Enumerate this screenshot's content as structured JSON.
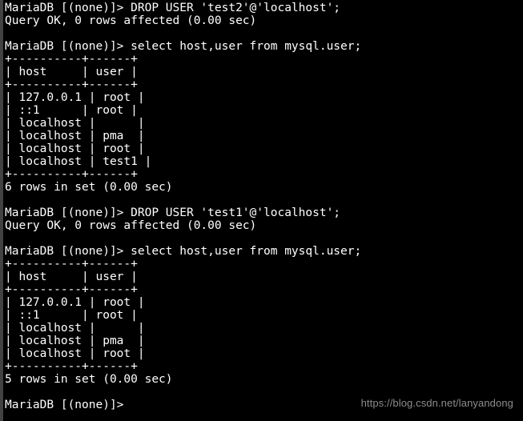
{
  "terminal": {
    "prompt": "MariaDB [(none)]> ",
    "background_color": "#000000",
    "foreground_color": "#ffffff",
    "lines": [
      "MariaDB [(none)]> DROP USER 'test2'@'localhost';",
      "Query OK, 0 rows affected (0.00 sec)",
      "",
      "MariaDB [(none)]> select host,user from mysql.user;",
      "+----------+------+",
      "| host     | user |",
      "+----------+------+",
      "| 127.0.0.1 | root |",
      "| ::1      | root |",
      "| localhost |      |",
      "| localhost | pma  |",
      "| localhost | root |",
      "| localhost | test1 |",
      "+----------+------+",
      "6 rows in set (0.00 sec)",
      "",
      "MariaDB [(none)]> DROP USER 'test1'@'localhost';",
      "Query OK, 0 rows affected (0.00 sec)",
      "",
      "MariaDB [(none)]> select host,user from mysql.user;",
      "+----------+------+",
      "| host     | user |",
      "+----------+------+",
      "| 127.0.0.1 | root |",
      "| ::1      | root |",
      "| localhost |      |",
      "| localhost | pma  |",
      "| localhost | root |",
      "+----------+------+",
      "5 rows in set (0.00 sec)",
      "",
      "MariaDB [(none)]> "
    ],
    "commands": [
      {
        "prompt": "MariaDB [(none)]>",
        "command": "DROP USER 'test2'@'localhost';",
        "result": "Query OK, 0 rows affected (0.00 sec)"
      },
      {
        "prompt": "MariaDB [(none)]>",
        "command": "select host,user from mysql.user;",
        "result": "6 rows in set (0.00 sec)"
      },
      {
        "prompt": "MariaDB [(none)]>",
        "command": "DROP USER 'test1'@'localhost';",
        "result": "Query OK, 0 rows affected (0.00 sec)"
      },
      {
        "prompt": "MariaDB [(none)]>",
        "command": "select host,user from mysql.user;",
        "result": "5 rows in set (0.00 sec)"
      }
    ],
    "result_tables": [
      {
        "columns": [
          "host",
          "user"
        ],
        "rows": [
          [
            "127.0.0.1",
            "root"
          ],
          [
            "::1",
            "root"
          ],
          [
            "localhost",
            ""
          ],
          [
            "localhost",
            "pma"
          ],
          [
            "localhost",
            "root"
          ],
          [
            "localhost",
            "test1"
          ]
        ],
        "row_count_text": "6 rows in set (0.00 sec)"
      },
      {
        "columns": [
          "host",
          "user"
        ],
        "rows": [
          [
            "127.0.0.1",
            "root"
          ],
          [
            "::1",
            "root"
          ],
          [
            "localhost",
            ""
          ],
          [
            "localhost",
            "pma"
          ],
          [
            "localhost",
            "root"
          ]
        ],
        "row_count_text": "5 rows in set (0.00 sec)"
      }
    ]
  },
  "watermark": {
    "text": "https://blog.csdn.net/lanyandong",
    "color": "#8c8c8c"
  }
}
